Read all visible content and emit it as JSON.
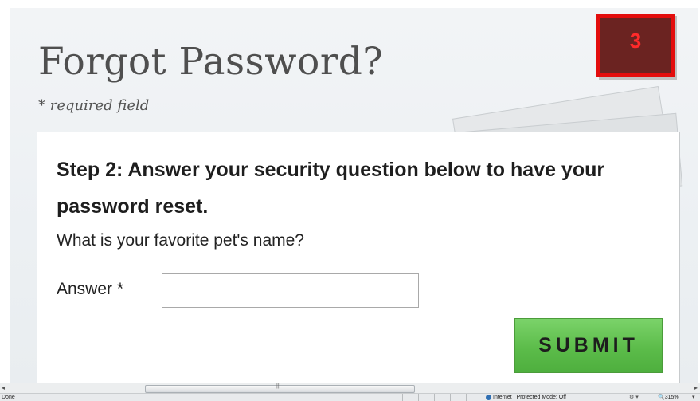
{
  "page": {
    "title": "Forgot Password?",
    "required_note": "* required field",
    "badge": "3"
  },
  "form": {
    "heading": "Step 2: Answer your security question below to have your password reset.",
    "question": "What is your favorite pet's name?",
    "answer_label": "Answer *",
    "answer_value": "",
    "submit_label": "SUBMIT"
  },
  "browser": {
    "status_text": "Done",
    "zone_text": "Internet | Protected Mode: Off",
    "zoom_text": "315%"
  },
  "colors": {
    "badge_border": "#e30d0d",
    "badge_fill": "#6b2321",
    "submit_green": "#5cbc4a"
  }
}
